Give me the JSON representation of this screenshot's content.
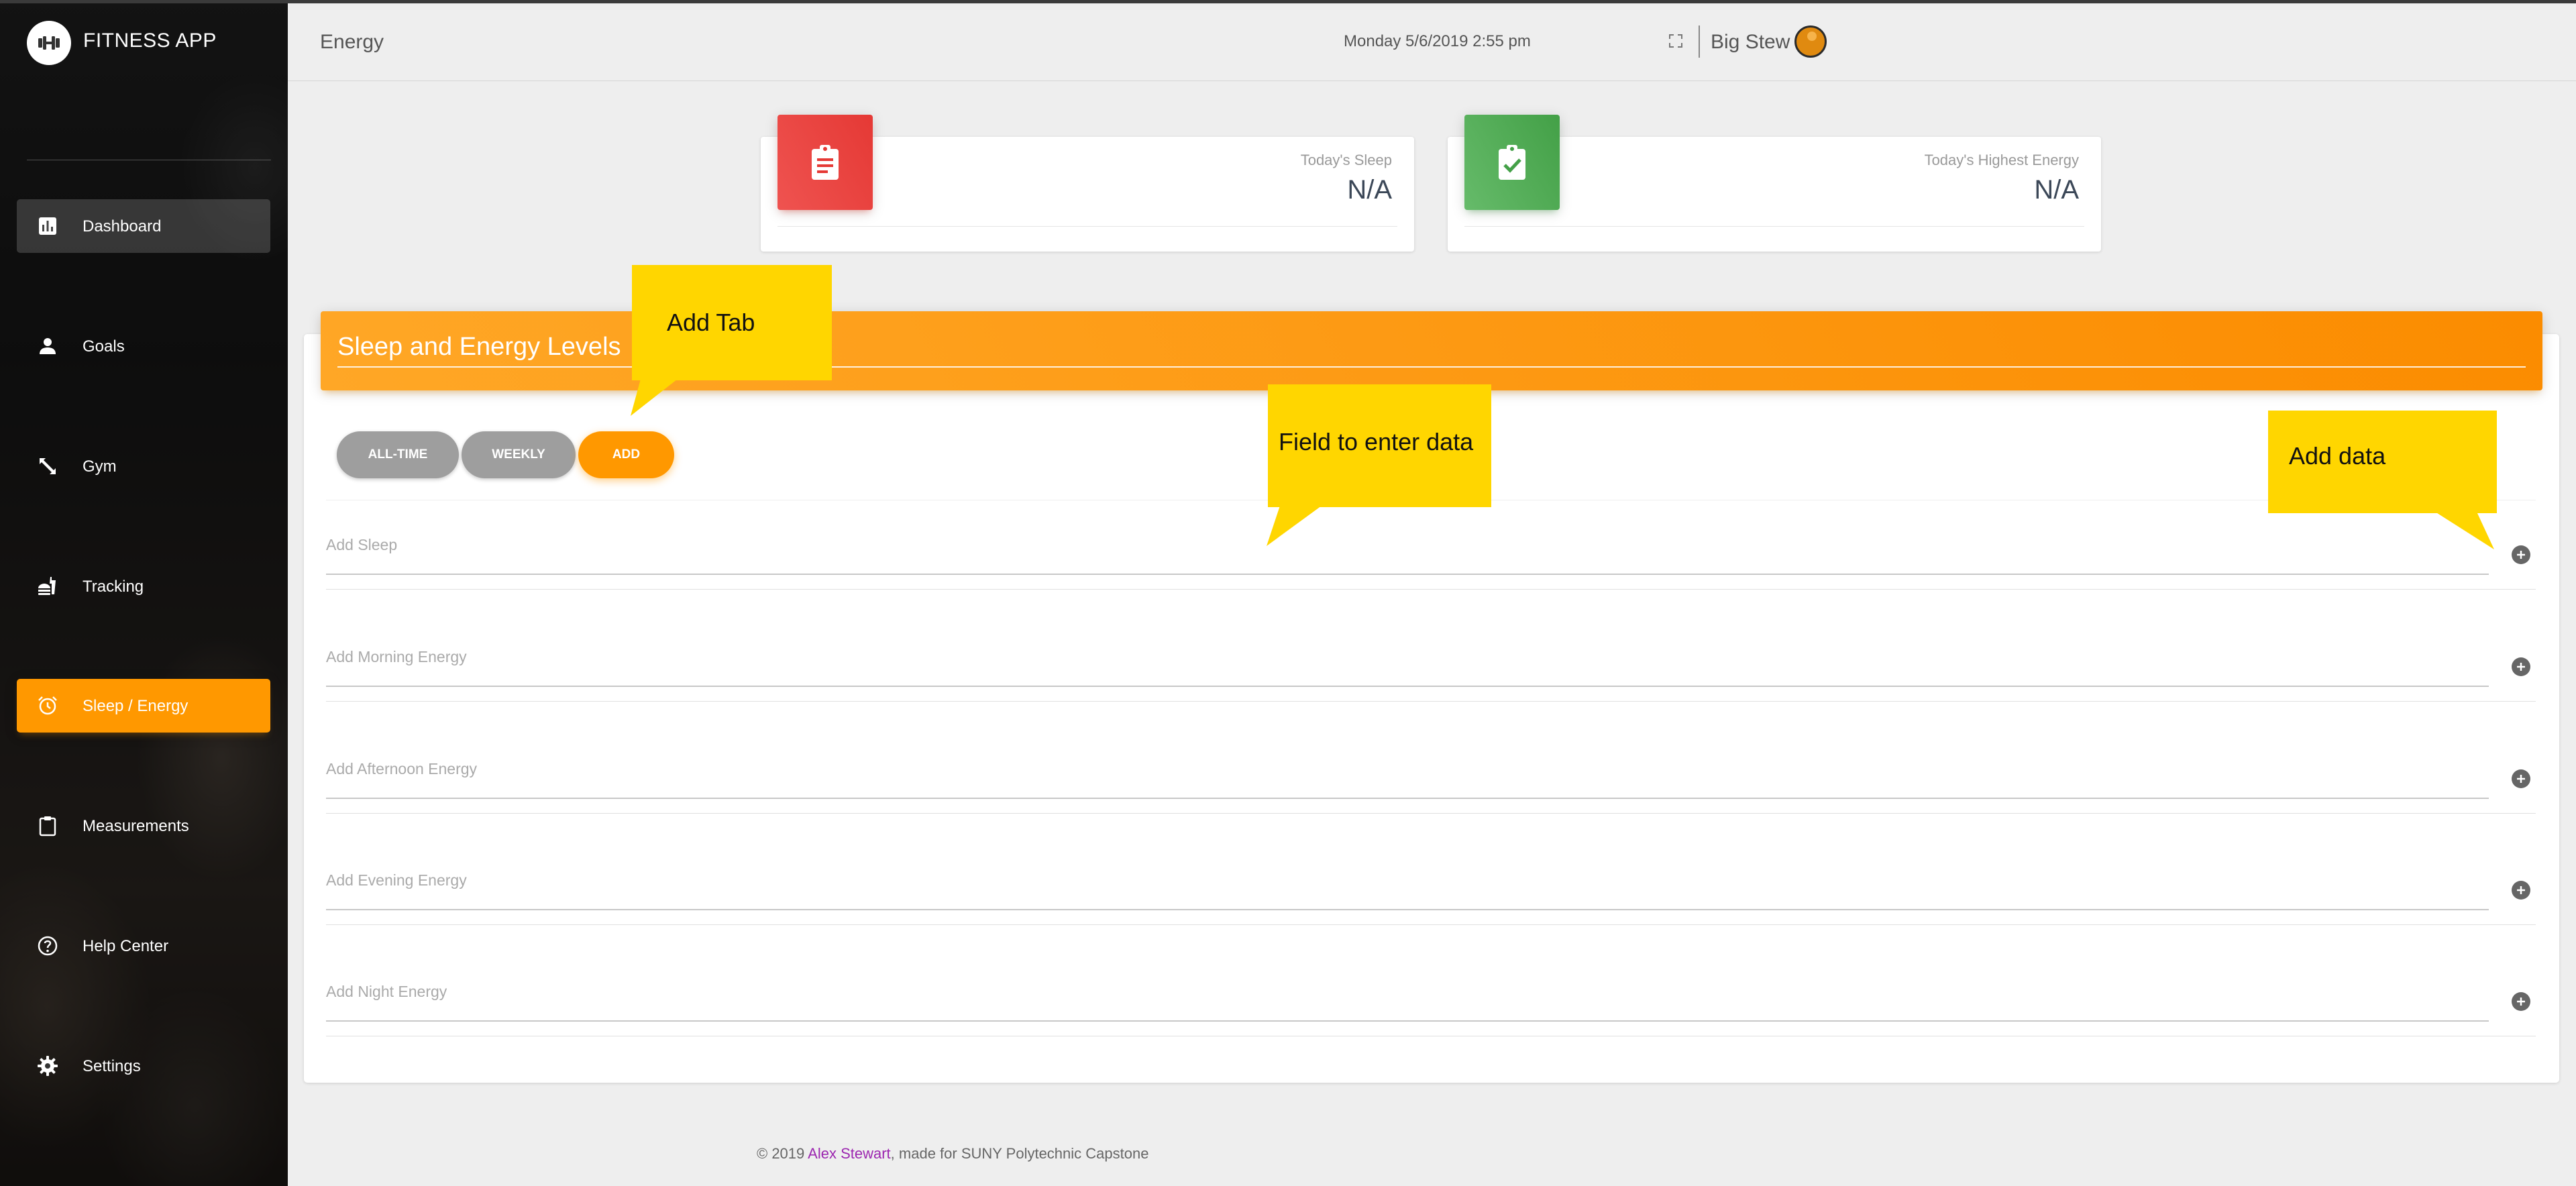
{
  "app": {
    "name": "FITNESS APP"
  },
  "sidebar": {
    "items": [
      {
        "label": "Dashboard",
        "icon": "bar-chart-icon",
        "state": "hover"
      },
      {
        "label": "Goals",
        "icon": "person-icon",
        "state": "normal"
      },
      {
        "label": "Gym",
        "icon": "expand-arrows-icon",
        "state": "normal"
      },
      {
        "label": "Tracking",
        "icon": "fastfood-icon",
        "state": "normal"
      },
      {
        "label": "Sleep / Energy",
        "icon": "alarm-icon",
        "state": "active"
      },
      {
        "label": "Measurements",
        "icon": "clipboard-icon",
        "state": "normal"
      },
      {
        "label": "Help Center",
        "icon": "help-circle-icon",
        "state": "normal"
      },
      {
        "label": "Settings",
        "icon": "gear-icon",
        "state": "normal"
      }
    ]
  },
  "header": {
    "title": "Energy",
    "datetime": "Monday 5/6/2019 2:55 pm",
    "user_name": "Big Stew"
  },
  "stats": [
    {
      "label": "Today's Sleep",
      "value": "N/A",
      "color": "#e53935",
      "icon": "assignment-icon"
    },
    {
      "label": "Today's Highest Energy",
      "value": "N/A",
      "color": "#43a047",
      "icon": "assignment-check-icon"
    }
  ],
  "card": {
    "title": "Sleep and Energy Levels",
    "tabs": [
      {
        "label": "ALL-TIME",
        "active": false
      },
      {
        "label": "WEEKLY",
        "active": false
      },
      {
        "label": "ADD",
        "active": true
      }
    ],
    "fields": [
      {
        "label": "Add Sleep",
        "value": ""
      },
      {
        "label": "Add Morning Energy",
        "value": ""
      },
      {
        "label": "Add Afternoon Energy",
        "value": ""
      },
      {
        "label": "Add Evening Energy",
        "value": ""
      },
      {
        "label": "Add Night Energy",
        "value": ""
      }
    ]
  },
  "annotations": {
    "add_tab": "Add Tab",
    "field_to_enter_data": "Field to enter data",
    "add_data": "Add data"
  },
  "footer": {
    "prefix": "© 2019 ",
    "author": "Alex Stewart",
    "suffix": ", made for SUNY Polytechnic Capstone"
  },
  "colors": {
    "accent": "#ff9800",
    "sleep_card": "#e53935",
    "energy_card": "#43a047",
    "callout": "#ffd600",
    "footer_link": "#9c27b0"
  }
}
